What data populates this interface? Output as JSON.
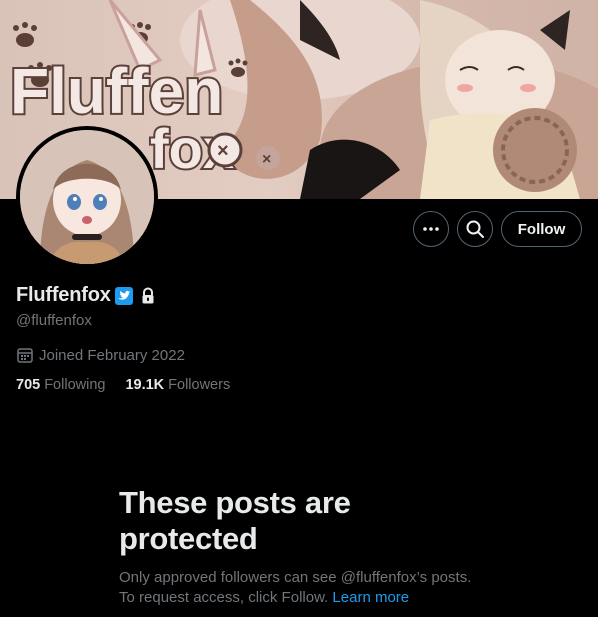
{
  "profile": {
    "display_name": "Fluffenfox",
    "handle": "@fluffenfox",
    "joined": "Joined February 2022",
    "following_count": "705",
    "following_label": "Following",
    "followers_count": "19.1K",
    "followers_label": "Followers",
    "verified": true,
    "protected": true
  },
  "banner": {
    "logo_text": [
      "Fluffen",
      "fox"
    ]
  },
  "actions": {
    "more_icon": "more-icon",
    "search_icon": "search-icon",
    "follow_label": "Follow"
  },
  "protected_notice": {
    "title": "These posts are protected",
    "description": "Only approved followers can see @fluffenfox’s posts. To request access, click Follow.",
    "link_label": "Learn more"
  },
  "colors": {
    "background": "#000000",
    "primary_text": "#e7e9ea",
    "secondary_text": "#71767b",
    "accent": "#1d9bf0",
    "border": "#536471"
  }
}
